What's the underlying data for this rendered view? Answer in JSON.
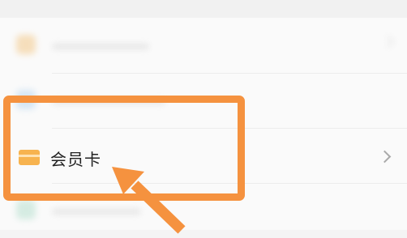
{
  "list": {
    "items": [
      {
        "label": "",
        "icon": "blurred-yellow-icon"
      },
      {
        "label": "",
        "icon": "blurred-blue-icon"
      },
      {
        "label": "会员卡",
        "icon": "card-icon",
        "highlighted": true
      },
      {
        "label": "",
        "icon": "blurred-green-icon"
      }
    ]
  },
  "annotation": {
    "box_color": "#f5923f",
    "arrow_color": "#f5923f"
  },
  "colors": {
    "card_icon": "#f7b34f",
    "background": "#fafafa"
  }
}
